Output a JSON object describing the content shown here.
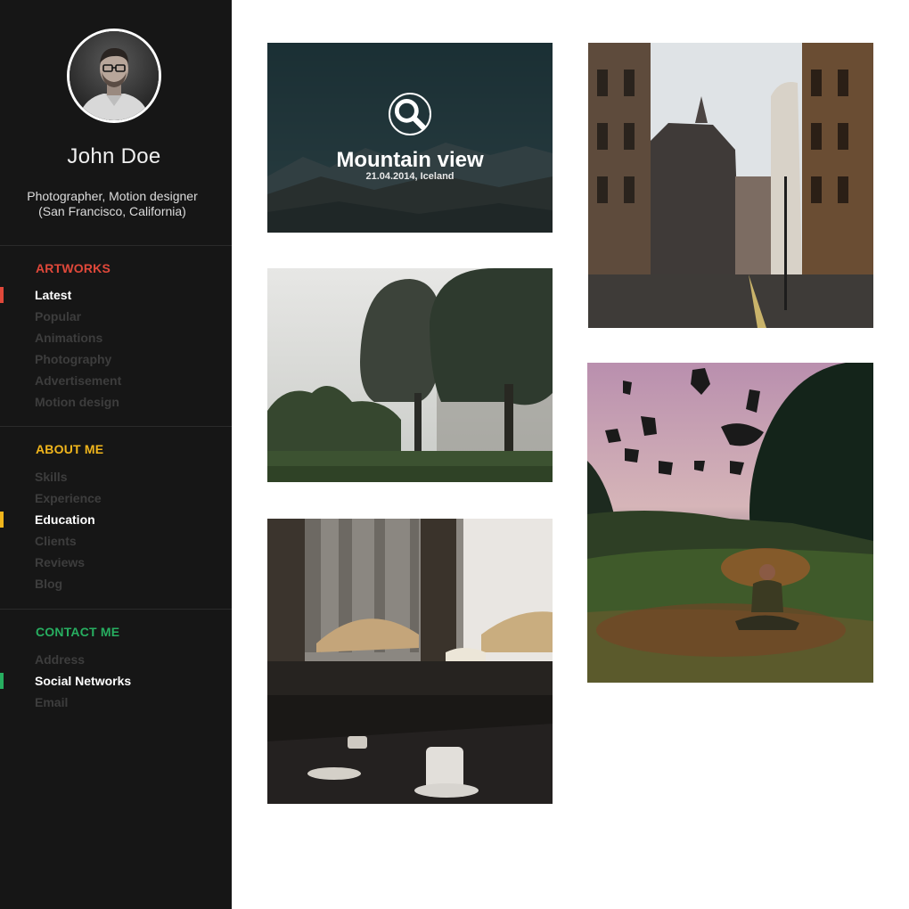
{
  "profile": {
    "name": "John Doe",
    "bio_line1": "Photographer, Motion designer",
    "bio_line2": "(San Francisco, California)"
  },
  "sections": {
    "artworks": {
      "title": "ARTWORKS",
      "color": "#e0483a",
      "items": [
        "Latest",
        "Popular",
        "Animations",
        "Photography",
        "Advertisement",
        "Motion design"
      ],
      "active": "Latest"
    },
    "about": {
      "title": "ABOUT ME",
      "color": "#f0b51c",
      "items": [
        "Skills",
        "Experience",
        "Education",
        "Clients",
        "Reviews",
        "Blog"
      ],
      "active": "Education"
    },
    "contact": {
      "title": "CONTACT ME",
      "color": "#27ae60",
      "items": [
        "Address",
        "Social Networks",
        "Email"
      ],
      "active": "Social Networks"
    }
  },
  "gallery": {
    "featured": {
      "title": "Mountain view",
      "subtitle": "21.04.2014, Iceland",
      "icon": "magnifier-icon"
    },
    "items": [
      {
        "name": "mountain-view",
        "description": "mountain landscape under dark teal overlay"
      },
      {
        "name": "trees-fog",
        "description": "topiary trees in fog"
      },
      {
        "name": "cafe",
        "description": "cafe with coffee cup near cathedral"
      },
      {
        "name": "street",
        "description": "old town street with buildings"
      },
      {
        "name": "leaves",
        "description": "person sitting in field with flying leaves"
      }
    ]
  }
}
